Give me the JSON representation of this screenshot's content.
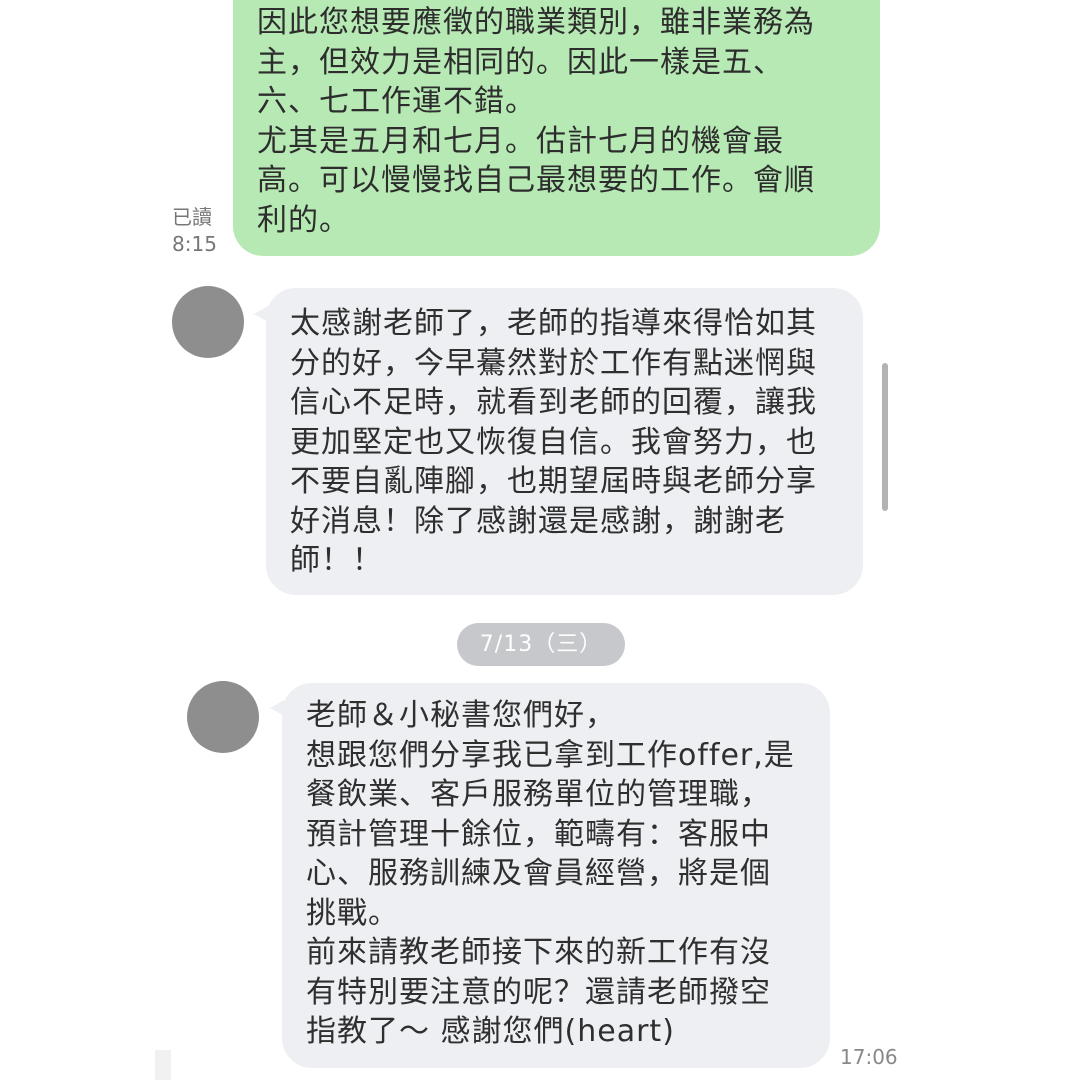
{
  "messages": [
    {
      "direction": "outgoing",
      "text": "因此您想要應徵的職業類別，雖非業務為\n主，但效力是相同的。因此一樣是五、\n六、七工作運不錯。\n尤其是五月和七月。估計七月的機會最\n高。可以慢慢找自己最想要的工作。會順\n利的。",
      "read_status": "已讀",
      "time": "8:15"
    },
    {
      "direction": "incoming",
      "text": "太感謝老師了，老師的指導來得恰如其\n分的好，今早驀然對於工作有點迷惘與\n信心不足時，就看到老師的回覆，讓我\n更加堅定也又恢復自信。我會努力，也\n不要自亂陣腳，也期望屆時與老師分享\n好消息！除了感謝還是感謝，謝謝老\n師！！"
    },
    {
      "direction": "incoming",
      "text": "老師＆小秘書您們好，\n想跟您們分享我已拿到工作offer,是\n餐飲業、客戶服務單位的管理職，\n預計管理十餘位，範疇有：客服中\n心、服務訓練及會員經營，將是個\n挑戰。\n前來請教老師接下來的新工作有沒\n有特別要注意的呢？還請老師撥空\n指教了～ 感謝您們(heart)",
      "time": "17:06"
    }
  ],
  "date_separator": "7/13（三）",
  "colors": {
    "outgoing_bubble": "#b7e9b4",
    "incoming_bubble": "#eeeff2",
    "date_pill": "#c7c8cb",
    "avatar": "#8e8e8e"
  }
}
